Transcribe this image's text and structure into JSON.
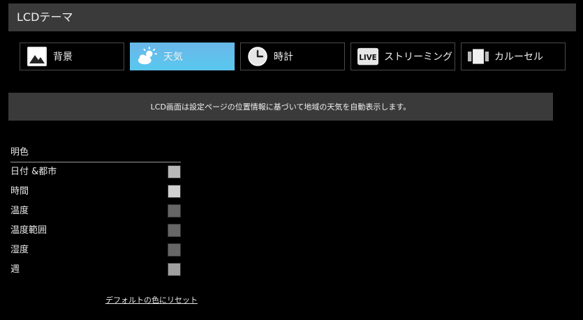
{
  "header": {
    "title": "LCDテーマ"
  },
  "tabs": [
    {
      "label": "背景",
      "icon": "image-icon",
      "active": false
    },
    {
      "label": "天気",
      "icon": "weather-icon",
      "active": true
    },
    {
      "label": "時計",
      "icon": "clock-icon",
      "active": false
    },
    {
      "label": "ストリーミング",
      "icon": "live-icon",
      "icon_text": "LIVE",
      "active": false
    },
    {
      "label": "カルーセル",
      "icon": "carousel-icon",
      "active": false
    }
  ],
  "info": {
    "text": "LCD画面は設定ページの位置情報に基づいて地域の天気を自動表示します。"
  },
  "colors": {
    "section_title": "明色",
    "rows": [
      {
        "label": "日付 &都市",
        "color": "#b9b9b9"
      },
      {
        "label": "時間",
        "color": "#d0d0d0"
      },
      {
        "label": "温度",
        "color": "#666666"
      },
      {
        "label": "温度範囲",
        "color": "#666666"
      },
      {
        "label": "湿度",
        "color": "#666666"
      },
      {
        "label": "週",
        "color": "#a0a0a0"
      }
    ],
    "reset_label": "デフォルトの色にリセット"
  },
  "accent": "#58c8ee"
}
